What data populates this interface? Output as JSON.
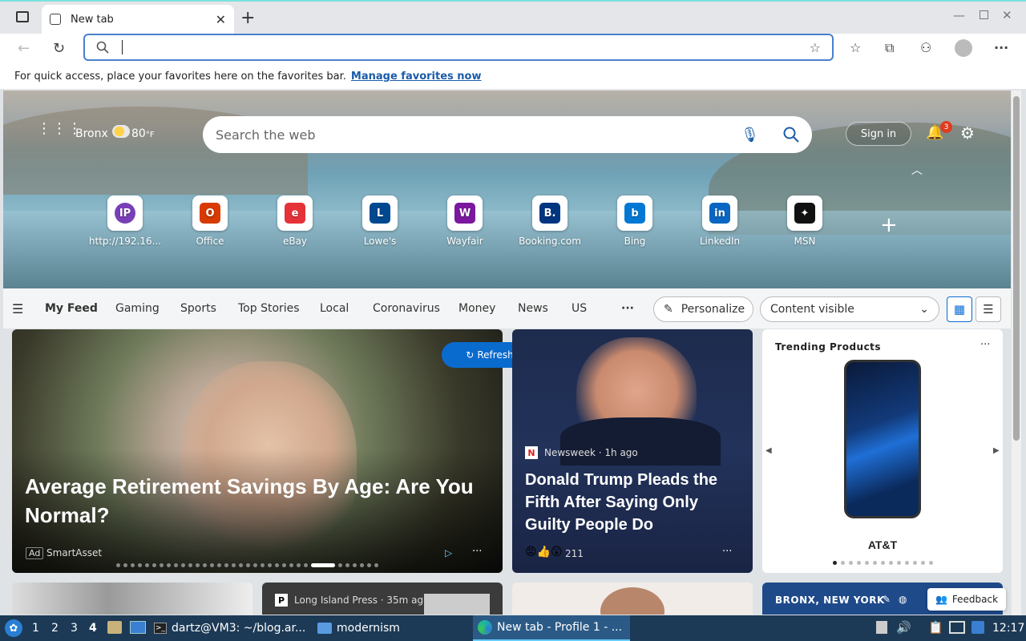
{
  "browser": {
    "tab_title": "New tab",
    "favbar_text": "For quick access, place your favorites here on the favorites bar.",
    "favbar_link": "Manage favorites now"
  },
  "hero": {
    "location": "Bronx",
    "temperature": "80",
    "temp_unit": "°F",
    "search_placeholder": "Search the web",
    "signin": "Sign in",
    "notif_count": "3",
    "quick_links": [
      {
        "label": "http://192.16...",
        "glyph": "IP",
        "color": "#7a3fb8"
      },
      {
        "label": "Office",
        "glyph": "O",
        "color": "#d83b01"
      },
      {
        "label": "eBay",
        "glyph": "e",
        "color": "#e53238"
      },
      {
        "label": "Lowe's",
        "glyph": "L",
        "color": "#004990"
      },
      {
        "label": "Wayfair",
        "glyph": "W",
        "color": "#7b189f"
      },
      {
        "label": "Booking.com",
        "glyph": "B.",
        "color": "#003580"
      },
      {
        "label": "Bing",
        "glyph": "b",
        "color": "#0078d4"
      },
      {
        "label": "LinkedIn",
        "glyph": "in",
        "color": "#0a66c2"
      },
      {
        "label": "MSN",
        "glyph": "✦",
        "color": "#111111"
      }
    ]
  },
  "nav": {
    "items": [
      "My Feed",
      "Gaming",
      "Sports",
      "Top Stories",
      "Local",
      "Coronavirus",
      "Money",
      "News",
      "US"
    ],
    "more": "···",
    "personalize": "Personalize",
    "content_visible": "Content visible"
  },
  "cards": {
    "refresh": "Refresh stories",
    "main": {
      "title": "Average Retirement Savings By Age: Are You Normal?",
      "ad": "Ad",
      "source": "SmartAsset"
    },
    "second": {
      "source": "Newsweek · 1h ago",
      "source_initial": "N",
      "title": "Donald Trump Pleads the Fifth After Saying Only Guilty People Do",
      "reactions": "211"
    },
    "trending": {
      "header": "Trending Products",
      "product": "AT&T"
    },
    "row2": {
      "source": "Long Island Press · 35m ag",
      "weather": "BRONX, NEW YORK"
    },
    "feedback": "Feedback"
  },
  "taskbar": {
    "workspaces": [
      "1",
      "2",
      "3",
      "4"
    ],
    "terminal": "dartz@VM3: ~/blog.ar...",
    "folder": "modernism",
    "browser": "New tab - Profile 1 - ...",
    "clock": "12:17"
  }
}
